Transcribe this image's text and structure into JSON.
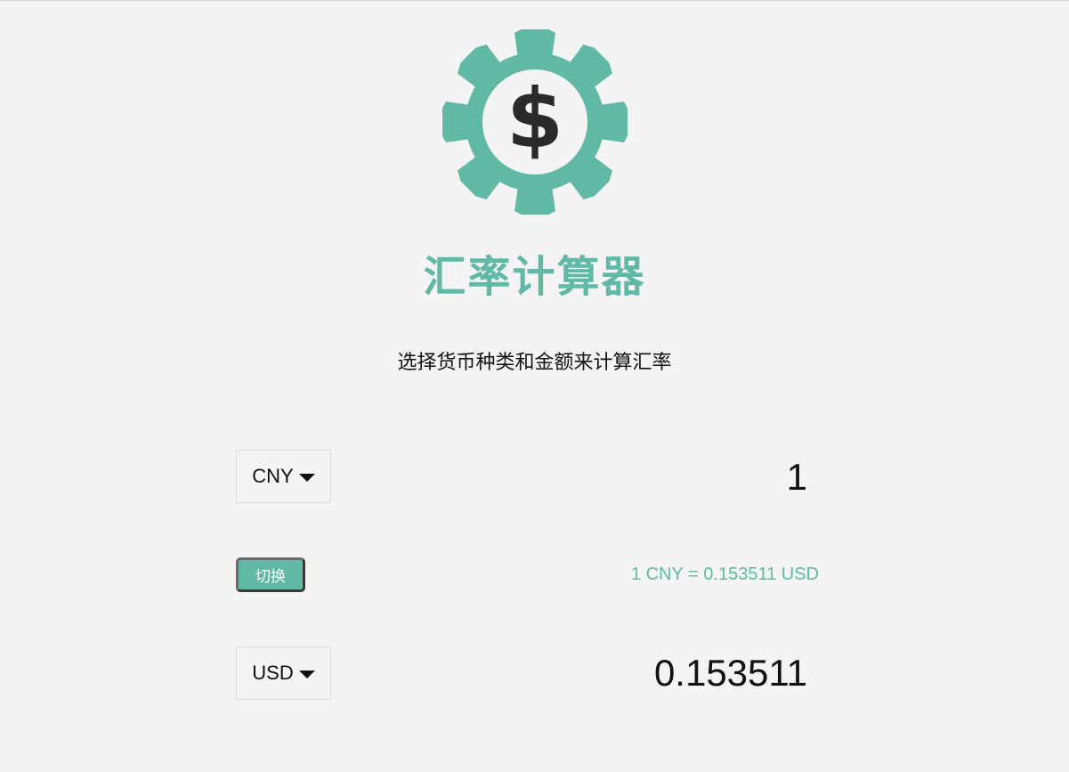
{
  "app": {
    "title": "汇率计算器",
    "subtitle": "选择货币种类和金额来计算汇率"
  },
  "logo": {
    "icon": "gear-dollar-icon",
    "gear_color": "#5fb9a5",
    "symbol_color": "#2a2a2a",
    "glyph": "$"
  },
  "from": {
    "currency": "CNY",
    "amount": "1"
  },
  "swap": {
    "label": "切换"
  },
  "rate": {
    "text": "1 CNY = 0.153511 USD"
  },
  "to": {
    "currency": "USD",
    "amount": "0.153511"
  },
  "colors": {
    "accent": "#5fb9a5",
    "background": "#f4f4f4"
  }
}
